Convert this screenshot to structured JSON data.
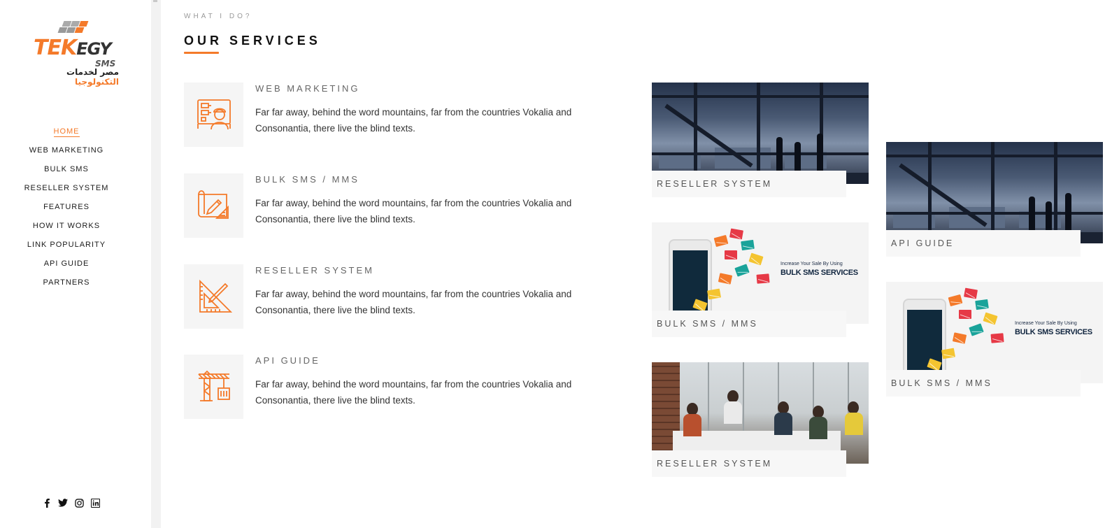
{
  "brand": {
    "name_part1": "TEK",
    "name_part2": "EGY",
    "sub": "SMS",
    "arabic_black": "مصر لخدمات ",
    "arabic_orange": "التكنولوجيا"
  },
  "nav": {
    "items": [
      {
        "label": "HOME",
        "active": true
      },
      {
        "label": "WEB MARKETING",
        "active": false
      },
      {
        "label": "BULK SMS",
        "active": false
      },
      {
        "label": "RESELLER SYSTEM",
        "active": false
      },
      {
        "label": "FEATURES",
        "active": false
      },
      {
        "label": "HOW IT WORKS",
        "active": false
      },
      {
        "label": "LINK POPULARITY",
        "active": false
      },
      {
        "label": "API GUIDE",
        "active": false
      },
      {
        "label": "PARTNERS",
        "active": false
      }
    ]
  },
  "social": [
    "facebook-icon",
    "twitter-icon",
    "instagram-icon",
    "linkedin-icon"
  ],
  "section": {
    "eyebrow": "WHAT I DO?",
    "title": "OUR SERVICES"
  },
  "services": [
    {
      "title": "WEB MARKETING",
      "desc": "Far far away, behind the word mountains, far from the countries Vokalia and Consonantia, there live the blind texts.",
      "icon": "engineer-blueprint-icon"
    },
    {
      "title": "BULK SMS / MMS",
      "desc": "Far far away, behind the word mountains, far from the countries Vokalia and Consonantia, there live the blind texts.",
      "icon": "blueprint-pencil-icon"
    },
    {
      "title": "RESELLER SYSTEM",
      "desc": "Far far away, behind the word mountains, far from the countries Vokalia and Consonantia, there live the blind texts.",
      "icon": "ruler-triangle-icon"
    },
    {
      "title": "API GUIDE",
      "desc": "Far far away, behind the word mountains, far from the countries Vokalia and Consonantia, there live the blind texts.",
      "icon": "crane-icon"
    }
  ],
  "gallery": {
    "left": [
      {
        "caption": "RESELLER SYSTEM",
        "image": "office-skyline-photo"
      },
      {
        "caption": "BULK SMS / MMS",
        "image": "bulk-sms-illustration"
      },
      {
        "caption": "RESELLER SYSTEM",
        "image": "team-meeting-photo"
      }
    ],
    "right": [
      {
        "caption": "API GUIDE",
        "image": "office-skyline-photo"
      },
      {
        "caption": "BULK SMS / MMS",
        "image": "bulk-sms-illustration"
      }
    ]
  },
  "sms_image_text": {
    "line1": "Increase Your Sale By Using",
    "line2": "BULK SMS SERVICES"
  },
  "colors": {
    "accent": "#f47a2a",
    "text": "#333333",
    "muted": "#666666",
    "panel": "#f5f5f5"
  }
}
